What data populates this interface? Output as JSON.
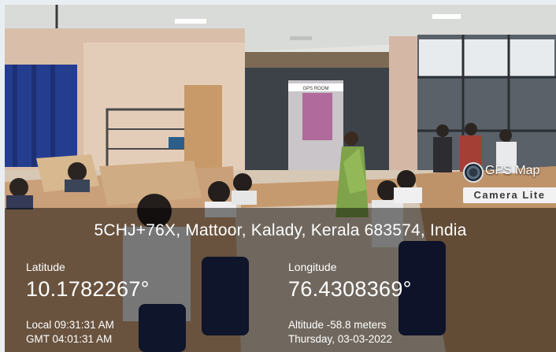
{
  "badge": {
    "icon": "camera-lens-icon",
    "title": "GPS Map",
    "subtitle": "Camera Lite"
  },
  "scene": {
    "room_sign": "GPS ROOM"
  },
  "location": {
    "address": "5CHJ+76X, Mattoor, Kalady, Kerala 683574, India",
    "latitude_label": "Latitude",
    "latitude_value": "10.1782267°",
    "longitude_label": "Longitude",
    "longitude_value": "76.4308369°",
    "local_time": "Local 09:31:31 AM",
    "gmt_time": "GMT 04:01:31 AM",
    "altitude": "Altitude -58.8 meters",
    "date": "Thursday, 03-03-2022"
  },
  "colors": {
    "overlay": "#000000",
    "text": "#ffffff",
    "badge_bg": "#f2f2f2"
  }
}
